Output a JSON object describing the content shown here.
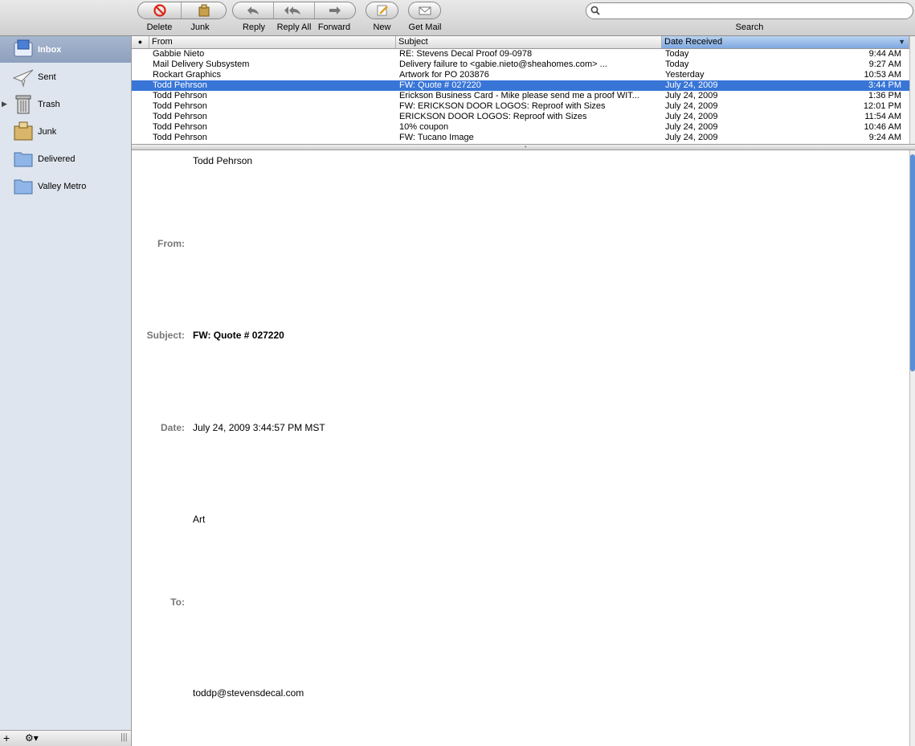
{
  "toolbar": {
    "delete": "Delete",
    "junk": "Junk",
    "reply": "Reply",
    "reply_all": "Reply All",
    "forward": "Forward",
    "new": "New",
    "get_mail": "Get Mail",
    "search_label": "Search",
    "search_placeholder": ""
  },
  "sidebar": {
    "items": [
      {
        "label": "Inbox",
        "icon": "inbox-icon"
      },
      {
        "label": "Sent",
        "icon": "sent-icon"
      },
      {
        "label": "Trash",
        "icon": "trash-icon"
      },
      {
        "label": "Junk",
        "icon": "junk-icon"
      },
      {
        "label": "Delivered",
        "icon": "folder-icon"
      },
      {
        "label": "Valley Metro",
        "icon": "folder-icon"
      }
    ]
  },
  "list": {
    "columns": {
      "from": "From",
      "subject": "Subject",
      "date": "Date Received"
    },
    "rows": [
      {
        "from": "Gabbie Nieto",
        "subject": "RE: Stevens Decal Proof 09-0978",
        "date": "Today",
        "time": "9:44 AM"
      },
      {
        "from": "Mail Delivery Subsystem",
        "subject": "Delivery failure to <gabie.nieto@sheahomes.com> ...",
        "date": "Today",
        "time": "9:27 AM"
      },
      {
        "from": "Rockart Graphics",
        "subject": "Artwork for PO 203876",
        "date": "Yesterday",
        "time": "10:53 AM"
      },
      {
        "from": "Todd Pehrson",
        "subject": "FW: Quote # 027220",
        "date": "July 24, 2009",
        "time": "3:44 PM"
      },
      {
        "from": "Todd Pehrson",
        "subject": "Erickson Business Card - Mike please send me a proof WIT...",
        "date": "July 24, 2009",
        "time": "1:36 PM"
      },
      {
        "from": "Todd Pehrson",
        "subject": "FW: ERICKSON DOOR LOGOS: Reproof with Sizes",
        "date": "July 24, 2009",
        "time": "12:01 PM"
      },
      {
        "from": "Todd Pehrson",
        "subject": "ERICKSON DOOR LOGOS: Reproof with Sizes",
        "date": "July 24, 2009",
        "time": "11:54 AM"
      },
      {
        "from": "Todd Pehrson",
        "subject": "10% coupon",
        "date": "July 24, 2009",
        "time": "10:46 AM"
      },
      {
        "from": "Todd Pehrson",
        "subject": "FW: Tucano Image",
        "date": "July 24, 2009",
        "time": "9:24 AM"
      }
    ]
  },
  "message": {
    "sender_top": "Todd Pehrson",
    "from_label": "From:",
    "subject_label": "Subject:",
    "subject": "FW: Quote # 027220",
    "date_label": "Date:",
    "date": "July 24, 2009 3:44:57 PM MST",
    "body_line": "Art",
    "to_label": "To:",
    "to": "toddp@stevensdecal.com"
  },
  "colors": {
    "selection": "#3875d7",
    "sidebar_bg": "#dfe5ee"
  }
}
